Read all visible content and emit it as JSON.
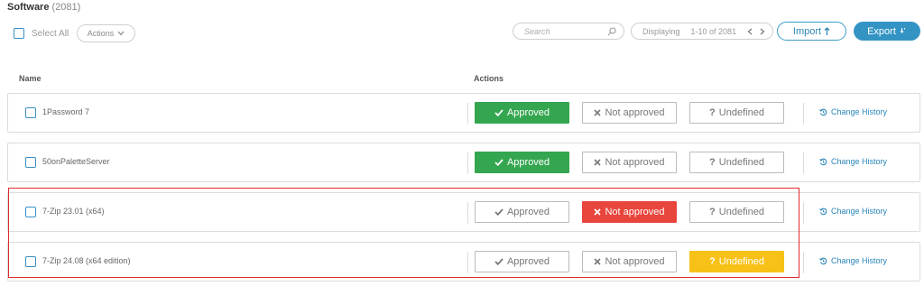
{
  "header": {
    "title": "Software",
    "count": "(2081)"
  },
  "toolbar": {
    "select_all": "Select All",
    "actions": "Actions",
    "search_placeholder": "Search",
    "displaying": "Displaying",
    "range": "1-10 of 2081",
    "import": "Import",
    "export": "Export"
  },
  "columns": {
    "name": "Name",
    "actions": "Actions"
  },
  "labels": {
    "approved": "Approved",
    "not_approved": "Not approved",
    "undefined": "Undefined",
    "change_history": "Change History"
  },
  "rows": [
    {
      "name": "1Password 7",
      "status": "approved"
    },
    {
      "name": "50onPaletteServer",
      "status": "approved"
    },
    {
      "name": "7-Zip 23.01 (x64)",
      "status": "not_approved"
    },
    {
      "name": "7-Zip 24.08 (x64 edition)",
      "status": "undefined"
    }
  ],
  "colors": {
    "approved": "#34a64f",
    "not_approved": "#e8453c",
    "undefined": "#f7c117",
    "accent": "#3394c4",
    "highlight": "#e02a2a"
  },
  "icons": [
    "search-icon",
    "chevron-down-icon",
    "chevron-left-icon",
    "chevron-right-icon",
    "upload-icon",
    "download-icon",
    "check-icon",
    "x-icon",
    "question-icon",
    "history-icon"
  ]
}
